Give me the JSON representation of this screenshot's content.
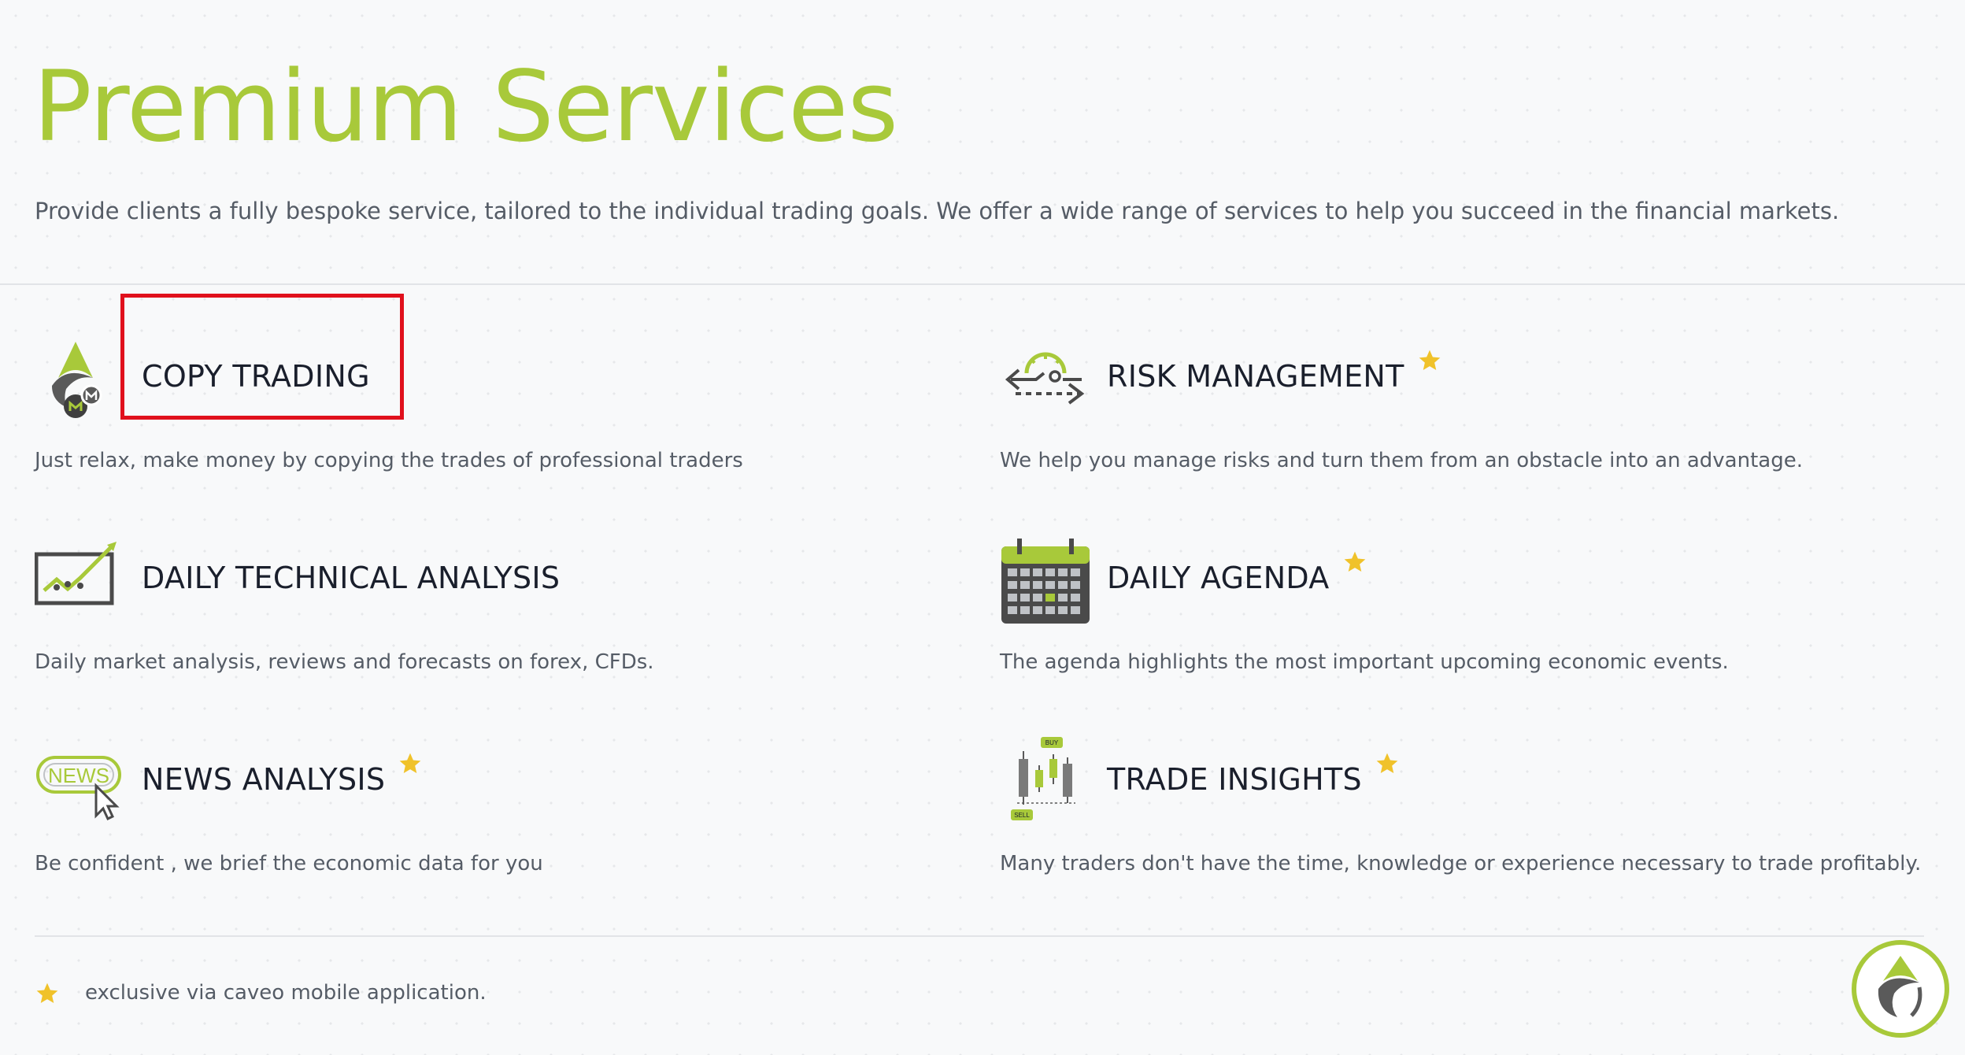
{
  "header": {
    "title": "Premium Services",
    "intro": "Provide clients a fully bespoke service, tailored to the individual trading goals. We offer a wide range of services to help you succeed in the financial markets."
  },
  "services": [
    {
      "title": "COPY TRADING",
      "description": "Just relax, make money by copying the trades of professional traders",
      "exclusive": false,
      "icon": "copy-trading-icon"
    },
    {
      "title": "RISK MANAGEMENT",
      "description": "We help you manage risks and turn them from an obstacle into an advantage.",
      "exclusive": true,
      "icon": "risk-gauge-icon"
    },
    {
      "title": "DAILY TECHNICAL ANALYSIS",
      "description": "Daily market analysis, reviews and forecasts on forex, CFDs.",
      "exclusive": false,
      "icon": "trend-chart-icon"
    },
    {
      "title": "DAILY AGENDA",
      "description": "The agenda highlights the most important upcoming economic events.",
      "exclusive": true,
      "icon": "calendar-icon"
    },
    {
      "title": "NEWS ANALYSIS",
      "description": "Be confident , we brief the economic data for you",
      "exclusive": true,
      "icon": "news-icon"
    },
    {
      "title": "TRADE INSIGHTS",
      "description": "Many traders don't have the time, knowledge or experience necessary to trade profitably.",
      "exclusive": true,
      "icon": "candlestick-icon"
    }
  ],
  "icon_text": {
    "news": "NEWS",
    "buy": "BUY",
    "sell": "SELL"
  },
  "footer": {
    "note": "exclusive via caveo mobile application."
  },
  "colors": {
    "accent": "#a8c93a",
    "star": "#f0c22a",
    "highlight": "#e0101c",
    "icon_gray": "#4a4a4a"
  }
}
